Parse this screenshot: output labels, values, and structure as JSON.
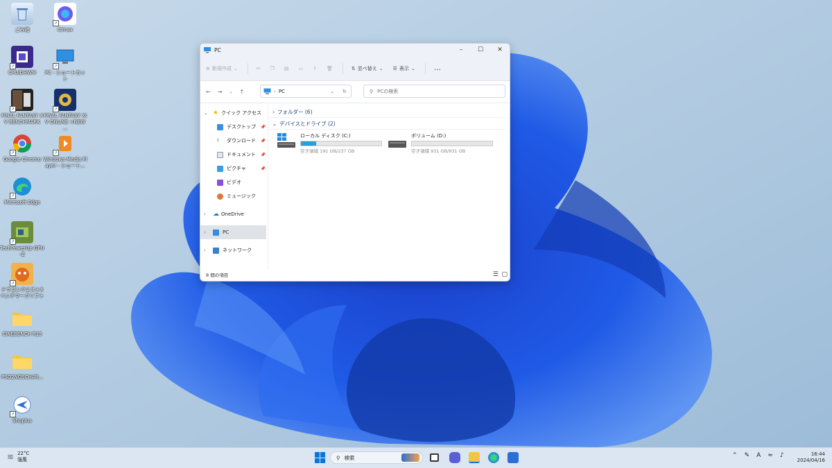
{
  "desktop": {
    "icons": [
      {
        "label": "ごみ箱",
        "icon": "recycle-bin-icon"
      },
      {
        "label": "Clmax",
        "icon": "app-icon"
      },
      {
        "label": "CPUIDHWM ",
        "icon": "cpuid-icon"
      },
      {
        "label": "PC - ショートカット",
        "icon": "pc-icon"
      },
      {
        "label": "FINAL FANTASY XV BENCHMARK",
        "icon": "ffxv-icon"
      },
      {
        "label": "FINAL FANTASY XIV ONLINE ×NEW ...",
        "icon": "ffxiv-icon"
      },
      {
        "label": "Google Chrome",
        "icon": "chrome-icon"
      },
      {
        "label": "Windows Media Player - ショート...",
        "icon": "media-player-icon"
      },
      {
        "label": "Microsoft Edge",
        "icon": "edge-icon"
      },
      {
        "label": "TechPowerUp GPU-Z",
        "icon": "gpuz-icon"
      },
      {
        "label": "ドラゴンクエストX ベンチマークソフト",
        "icon": "dqx-icon"
      },
      {
        "label": "CINEBENCH R15",
        "icon": "folder-icon"
      },
      {
        "label": "PSO2NGSCHAR...",
        "icon": "folder-icon"
      },
      {
        "label": "Shoplus",
        "icon": "app-icon"
      }
    ]
  },
  "explorer": {
    "title": "PC",
    "toolbar": {
      "new_label": "新規作成",
      "sort_label": "並べ替え",
      "view_label": "表示",
      "more_label": "…"
    },
    "address": {
      "path": "PC",
      "search_placeholder": "PCの検索"
    },
    "nav": {
      "quick_access": "クイック アクセス",
      "items": [
        {
          "label": "デスクトップ",
          "pinned": true
        },
        {
          "label": "ダウンロード",
          "pinned": true
        },
        {
          "label": "ドキュメント",
          "pinned": true
        },
        {
          "label": "ピクチャ",
          "pinned": true
        },
        {
          "label": "ビデオ",
          "pinned": false
        },
        {
          "label": "ミュージック",
          "pinned": false
        }
      ],
      "onedrive": "OneDrive",
      "pc": "PC",
      "network": "ネットワーク"
    },
    "content": {
      "folders_section": "フォルダー (6)",
      "drives_section": "デバイスとドライブ (2)",
      "drives": [
        {
          "name": "ローカル ディスク (C:)",
          "free": "空き領域 191 GB/237 GB",
          "used_fraction": 0.19
        },
        {
          "name": "ボリューム (D:)",
          "free": "空き領域 931 GB/931 GB",
          "used_fraction": 0.0
        }
      ]
    },
    "status": "8 個の項目"
  },
  "taskbar": {
    "weather_temp": "22°C",
    "weather_desc": "強風",
    "search_label": "検索",
    "time": "16:44",
    "date": "2024/04/16",
    "ime": "A"
  },
  "colors": {
    "accent": "#0067c0",
    "wallpaper": "#a9c6e0",
    "bloom": "#1a4fd6"
  }
}
